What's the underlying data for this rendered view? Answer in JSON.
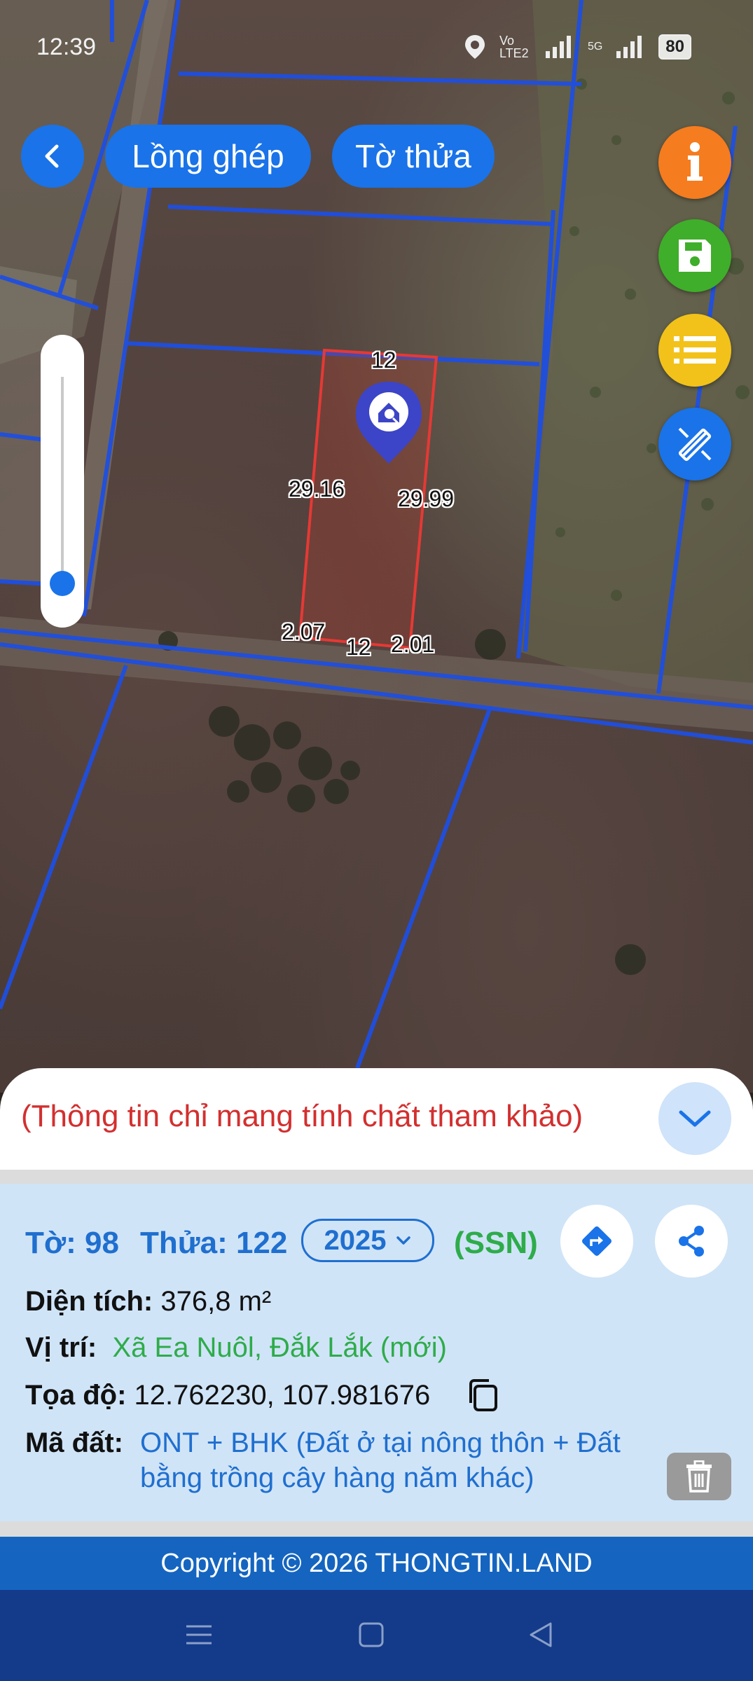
{
  "status_bar": {
    "time": "12:39",
    "network_label": "Vo LTE2",
    "network_5g": "5G",
    "battery": "80"
  },
  "top_bar": {
    "back_icon": "chevron-left-icon",
    "btn_layer": "Lồng ghép",
    "btn_sheet": "Tờ thửa"
  },
  "fab": {
    "info_icon": "info-icon",
    "info_color": "#f57c1f",
    "save_icon": "save-icon",
    "save_color": "#3fae2a",
    "list_icon": "list-icon",
    "list_color": "#f2c21b",
    "edit_icon": "ruler-pencil-icon",
    "edit_color": "#1a73e8"
  },
  "map": {
    "marker_icon": "house-search-icon",
    "parcel_labels": {
      "top": "12",
      "left": "29.16",
      "right": "29.99",
      "bottom": "12",
      "bottom_left": "2.07",
      "bottom_right": "2.01"
    }
  },
  "sheet": {
    "disclaimer": "(Thông tin chỉ mang tính chất tham khảo)",
    "collapse_icon": "chevron-down-icon",
    "to_label": "Tờ: 98",
    "thua_label": "Thửa: 122",
    "year": "2025",
    "ssn": "(SSN)",
    "directions_icon": "directions-icon",
    "share_icon": "share-icon",
    "area_label": "Diện tích:",
    "area_value": "376,8 m²",
    "location_label": "Vị trí:",
    "location_value": "Xã Ea Nuôl, Đắk Lắk (mới)",
    "coord_label": "Tọa độ:",
    "coord_value": "12.762230, 107.981676",
    "land_code_label": "Mã đất:",
    "land_code_line1": "ONT + BHK (Đất ở tại nông thôn + Đất",
    "land_code_line2": "bằng trồng cây hàng năm khác)",
    "trash_icon": "trash-icon"
  },
  "footer": {
    "copyright": "Copyright © 2026 THONGTIN.LAND"
  },
  "nav": {
    "menu_icon": "menu-icon",
    "home_icon": "square-icon",
    "back_icon": "triangle-back-icon"
  }
}
